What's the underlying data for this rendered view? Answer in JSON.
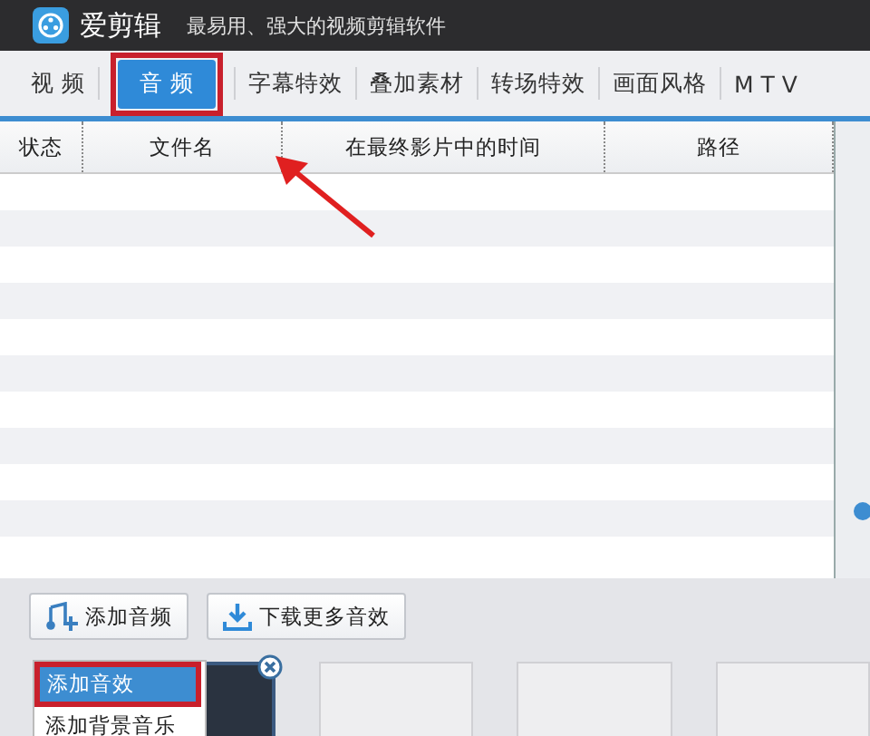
{
  "window": {
    "title": "爱剪辑",
    "subtitle": "最易用、强大的视频剪辑软件"
  },
  "tabs": [
    {
      "label": "视 频",
      "selected": false
    },
    {
      "label": "音 频",
      "selected": true
    },
    {
      "label": "字幕特效",
      "selected": false
    },
    {
      "label": "叠加素材",
      "selected": false
    },
    {
      "label": "转场特效",
      "selected": false
    },
    {
      "label": "画面风格",
      "selected": false
    },
    {
      "label": "M T V",
      "selected": false
    }
  ],
  "table": {
    "columns": [
      "状态",
      "文件名",
      "在最终影片中的时间",
      "路径"
    ]
  },
  "buttons": [
    {
      "label": "添加音频",
      "kind": "music"
    },
    {
      "label": "下载更多音效",
      "kind": "download"
    }
  ],
  "menu": [
    {
      "label": "添加音效",
      "selected": true
    },
    {
      "label": "添加背景音乐",
      "selected": false
    }
  ]
}
